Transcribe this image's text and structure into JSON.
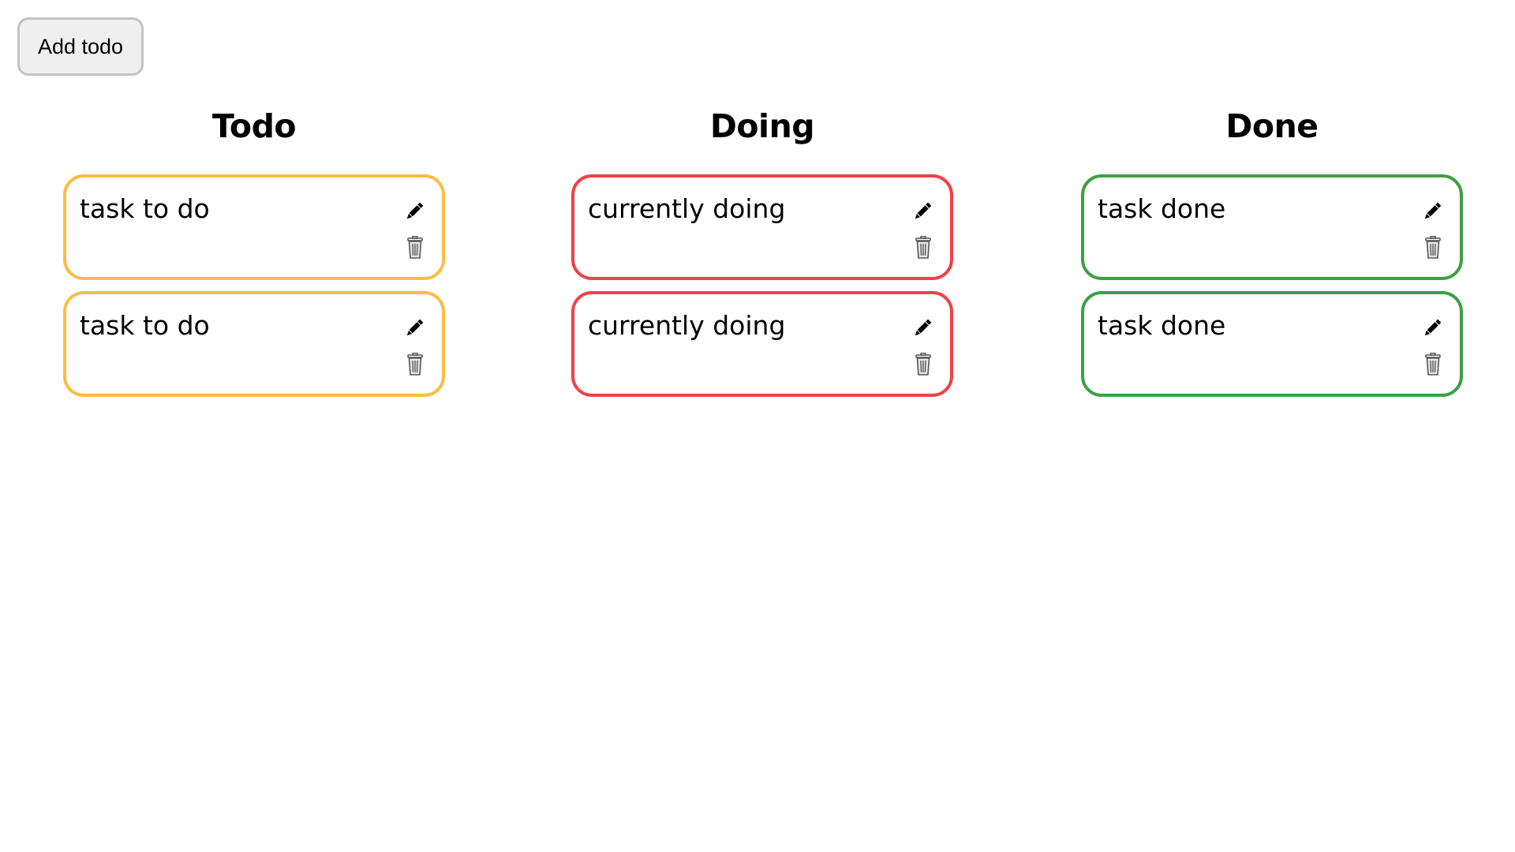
{
  "toolbar": {
    "add_label": "Add todo"
  },
  "columns": [
    {
      "title": "Todo",
      "border_color": "#fbbd44",
      "cards": [
        {
          "text": "task to do"
        },
        {
          "text": "task to do"
        }
      ]
    },
    {
      "title": "Doing",
      "border_color": "#ef4248",
      "cards": [
        {
          "text": "currently doing"
        },
        {
          "text": "currently doing"
        }
      ]
    },
    {
      "title": "Done",
      "border_color": "#3f9f45",
      "cards": [
        {
          "text": "task done"
        },
        {
          "text": "task done"
        }
      ]
    }
  ],
  "icons": {
    "edit": "pencil-icon",
    "delete": "trash-icon"
  }
}
